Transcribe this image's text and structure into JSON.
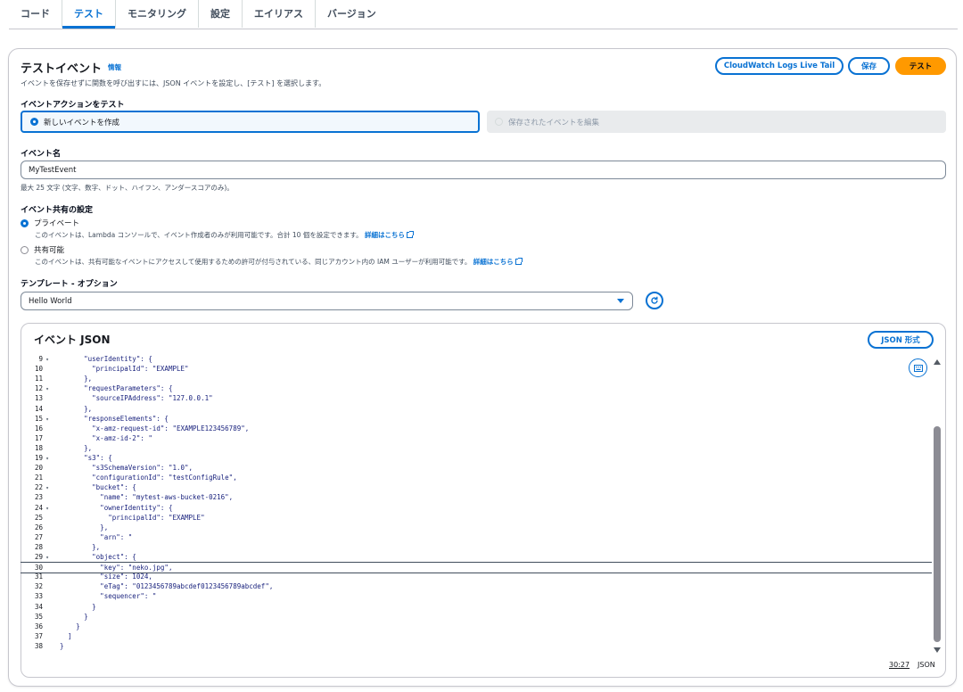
{
  "tabs": [
    {
      "label": "コード"
    },
    {
      "label": "テスト"
    },
    {
      "label": "モニタリング"
    },
    {
      "label": "設定"
    },
    {
      "label": "エイリアス"
    },
    {
      "label": "バージョン"
    }
  ],
  "header": {
    "title": "テストイベント",
    "info_link": "情報",
    "description": "イベントを保存せずに関数を呼び出すには、JSON イベントを設定し、[テスト] を選択します。",
    "buttons": {
      "live_tail": "CloudWatch Logs Live Tail",
      "save": "保存",
      "test": "テスト"
    }
  },
  "event_action": {
    "label": "イベントアクションをテスト",
    "create_new": "新しいイベントを作成",
    "edit_saved": "保存されたイベントを編集"
  },
  "event_name": {
    "label": "イベント名",
    "value": "MyTestEvent",
    "hint": "最大 25 文字 (文字、数字、ドット、ハイフン、アンダースコアのみ)。"
  },
  "sharing": {
    "label": "イベント共有の設定",
    "private_label": "プライベート",
    "private_desc": "このイベントは、Lambda コンソールで、イベント作成者のみが利用可能です。合計 10 個を設定できます。",
    "shareable_label": "共有可能",
    "shareable_desc": "このイベントは、共有可能なイベントにアクセスして使用するための許可が付与されている、同じアカウント内の IAM ユーザーが利用可能です。",
    "learn_more": "詳細はこちら"
  },
  "template": {
    "label": "テンプレート - オプション",
    "selected": "Hello World"
  },
  "editor": {
    "title": "イベント JSON",
    "format_button": "JSON 形式",
    "cursor_position": "30:27",
    "mode": "JSON",
    "lines": [
      {
        "n": "9",
        "fold": true,
        "text": "        \"userIdentity\": {"
      },
      {
        "n": "10",
        "fold": false,
        "text": "          \"principalId\": \"EXAMPLE\""
      },
      {
        "n": "11",
        "fold": false,
        "text": "        },"
      },
      {
        "n": "12",
        "fold": true,
        "text": "        \"requestParameters\": {"
      },
      {
        "n": "13",
        "fold": false,
        "text": "          \"sourceIPAddress\": \"127.0.0.1\""
      },
      {
        "n": "14",
        "fold": false,
        "text": "        },"
      },
      {
        "n": "15",
        "fold": true,
        "text": "        \"responseElements\": {"
      },
      {
        "n": "16",
        "fold": false,
        "text": "          \"x-amz-request-id\": \"EXAMPLE123456789\","
      },
      {
        "n": "17",
        "fold": false,
        "text": "          \"x-amz-id-2\": \""
      },
      {
        "n": "18",
        "fold": false,
        "text": "        },"
      },
      {
        "n": "19",
        "fold": true,
        "text": "        \"s3\": {"
      },
      {
        "n": "20",
        "fold": false,
        "text": "          \"s3SchemaVersion\": \"1.0\","
      },
      {
        "n": "21",
        "fold": false,
        "text": "          \"configurationId\": \"testConfigRule\","
      },
      {
        "n": "22",
        "fold": true,
        "text": "          \"bucket\": {"
      },
      {
        "n": "23",
        "fold": false,
        "text": "            \"name\": \"mytest-aws-bucket-0216\","
      },
      {
        "n": "24",
        "fold": true,
        "text": "            \"ownerIdentity\": {"
      },
      {
        "n": "25",
        "fold": false,
        "text": "              \"principalId\": \"EXAMPLE\""
      },
      {
        "n": "26",
        "fold": false,
        "text": "            },"
      },
      {
        "n": "27",
        "fold": false,
        "text": "            \"arn\": \""
      },
      {
        "n": "28",
        "fold": false,
        "text": "          },"
      },
      {
        "n": "29",
        "fold": true,
        "text": "          \"object\": {"
      },
      {
        "n": "30",
        "fold": false,
        "text": "            \"key\": \"neko.jpg\","
      },
      {
        "n": "31",
        "fold": false,
        "text": "            \"size\": 1024,"
      },
      {
        "n": "32",
        "fold": false,
        "text": "            \"eTag\": \"0123456789abcdef0123456789abcdef\","
      },
      {
        "n": "33",
        "fold": false,
        "text": "            \"sequencer\": \""
      },
      {
        "n": "34",
        "fold": false,
        "text": "          }"
      },
      {
        "n": "35",
        "fold": false,
        "text": "        }"
      },
      {
        "n": "36",
        "fold": false,
        "text": "      }"
      },
      {
        "n": "37",
        "fold": false,
        "text": "    ]"
      },
      {
        "n": "38",
        "fold": false,
        "text": "  }"
      }
    ]
  },
  "colors": {
    "accent": "#0972d3",
    "primary_button": "#ff9900"
  }
}
